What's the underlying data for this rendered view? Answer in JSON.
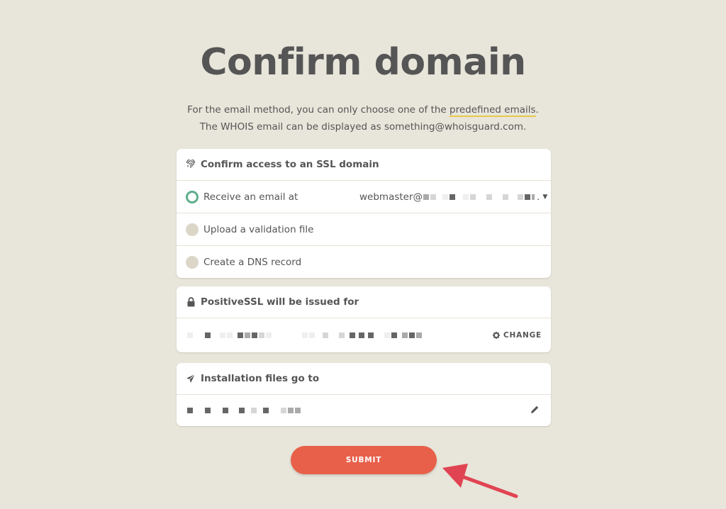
{
  "page": {
    "title": "Confirm domain",
    "intro_line1_prefix": "For the email method, you can only choose one of the ",
    "intro_line1_link": "predefined emails",
    "intro_line1_suffix": ".",
    "intro_line2": "The WHOIS email can be displayed as something@whoisguard.com."
  },
  "ssl_access": {
    "header": "Confirm access to an SSL domain",
    "header_icon": "fingerprint-icon",
    "options": [
      {
        "label": "Receive an email at",
        "selected": true
      },
      {
        "label": "Upload a validation file",
        "selected": false
      },
      {
        "label": "Create a DNS record",
        "selected": false
      }
    ],
    "email_prefix": "webmaster@"
  },
  "issued_for": {
    "header": "PositiveSSL will be issued for",
    "header_icon": "lock-icon",
    "change_label": "CHANGE",
    "change_icon": "gear-icon"
  },
  "installation": {
    "header": "Installation files go to",
    "header_icon": "paper-plane-icon",
    "edit_icon": "pencil-icon"
  },
  "submit_label": "SUBMIT",
  "colors": {
    "background": "#e8e5da",
    "accent_submit": "#e8604a",
    "selected_radio": "#5fae8d",
    "link_underline": "#e9c84a",
    "annotation_arrow": "#e04452"
  }
}
